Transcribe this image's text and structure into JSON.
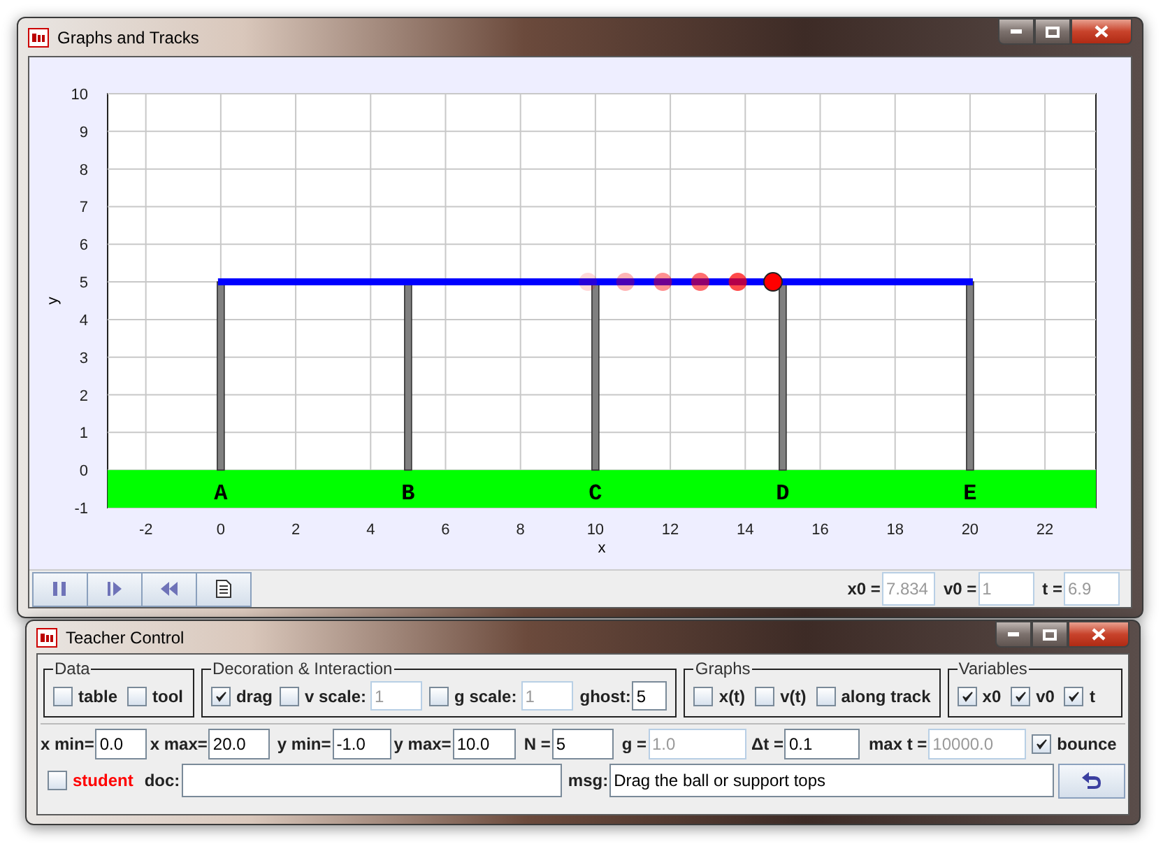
{
  "graph_window": {
    "title": "Graphs and Tracks",
    "plot": {
      "x_axis": {
        "title": "x",
        "ticks": [
          "-2",
          "0",
          "2",
          "4",
          "6",
          "8",
          "10",
          "12",
          "14",
          "16",
          "18",
          "20",
          "22"
        ]
      },
      "y_axis": {
        "title": "y",
        "ticks": [
          "10",
          "9",
          "8",
          "7",
          "6",
          "5",
          "4",
          "3",
          "2",
          "1",
          "0",
          "-1"
        ]
      },
      "supports": [
        {
          "label": "A"
        },
        {
          "label": "B"
        },
        {
          "label": "C"
        },
        {
          "label": "D"
        },
        {
          "label": "E"
        }
      ]
    },
    "readouts": [
      {
        "label": "x0 =",
        "value": "7.834",
        "disabled": true
      },
      {
        "label": "v0 =",
        "value": "1",
        "disabled": true
      },
      {
        "label": "t =",
        "value": "6.9",
        "disabled": true
      }
    ]
  },
  "control_window": {
    "title": "Teacher Control",
    "groups": [
      {
        "title": "Data",
        "items": [
          {
            "kind": "checkbox",
            "label": "table",
            "checked": false
          },
          {
            "kind": "checkbox",
            "label": "tool",
            "checked": false
          }
        ]
      },
      {
        "title": "Decoration & Interaction",
        "items": [
          {
            "kind": "checkbox",
            "label": "drag",
            "checked": true
          },
          {
            "kind": "checkfield",
            "label": "v scale:",
            "checked": false,
            "value": "1",
            "disabled": true
          },
          {
            "kind": "checkfield",
            "label": "g scale:",
            "checked": false,
            "value": "1",
            "disabled": true
          },
          {
            "kind": "field",
            "label": "ghost:",
            "value": "5",
            "disabled": false
          }
        ]
      },
      {
        "title": "Graphs",
        "items": [
          {
            "kind": "checkbox",
            "label": "x(t)",
            "checked": false
          },
          {
            "kind": "checkbox",
            "label": "v(t)",
            "checked": false
          },
          {
            "kind": "checkbox",
            "label": "along track",
            "checked": false
          }
        ]
      },
      {
        "title": "Variables",
        "items": [
          {
            "kind": "checkbox",
            "label": "x0",
            "checked": true
          },
          {
            "kind": "checkbox",
            "label": "v0",
            "checked": true
          },
          {
            "kind": "checkbox",
            "label": "t",
            "checked": true
          }
        ]
      }
    ],
    "parameters": [
      {
        "kind": "field",
        "label": "x min=",
        "value": "0.0",
        "disabled": false
      },
      {
        "kind": "field",
        "label": "x max=",
        "value": "20.0",
        "disabled": false
      },
      {
        "kind": "field",
        "label": "y min=",
        "value": "-1.0",
        "disabled": false
      },
      {
        "kind": "field",
        "label": "y max=",
        "value": "10.0",
        "disabled": false
      },
      {
        "kind": "field",
        "label": "N =",
        "value": "5",
        "disabled": false
      },
      {
        "kind": "field",
        "label": "g =",
        "value": "1.0",
        "disabled": true
      },
      {
        "kind": "field",
        "label": "Δt =",
        "value": "0.1",
        "disabled": false
      },
      {
        "kind": "field",
        "label": "max t =",
        "value": "10000.0",
        "disabled": true
      },
      {
        "kind": "checkbox",
        "label": "bounce",
        "checked": true
      }
    ],
    "student": {
      "label": "student",
      "checked": false,
      "color": "#ff0000"
    },
    "doc": {
      "label": "doc:"
    },
    "msg": {
      "label": "msg:",
      "value": "Drag the ball or support tops"
    }
  }
}
